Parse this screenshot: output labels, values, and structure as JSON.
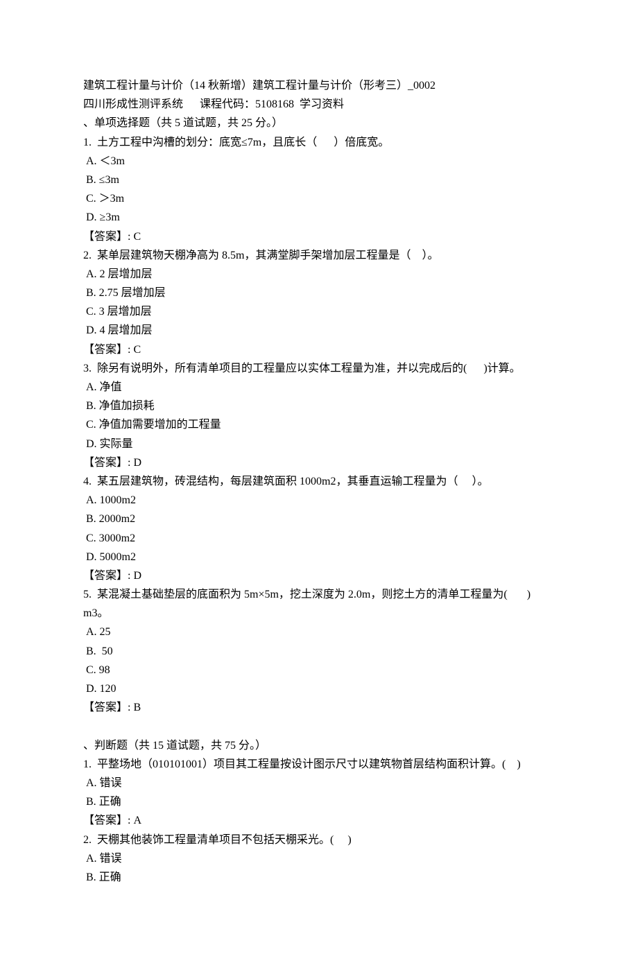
{
  "header": {
    "line1": "建筑工程计量与计价（14 秋新增）建筑工程计量与计价（形考三）_0002",
    "line2": "四川形成性测评系统      课程代码：5108168  学习资料"
  },
  "section1": {
    "title": "、单项选择题（共 5 道试题，共 25 分。）",
    "q1": {
      "stem": "1.  土方工程中沟槽的划分：底宽≤7m，且底长（      ）倍底宽。",
      "optA": " A. ＜3m",
      "optB": " B. ≤3m",
      "optC": " C. ＞3m",
      "optD": " D. ≥3m",
      "answer": "【答案】: C"
    },
    "q2": {
      "stem": "2.  某单层建筑物天棚净高为 8.5m，其满堂脚手架增加层工程量是（    ）。",
      "optA": " A. 2 层增加层",
      "optB": " B. 2.75 层增加层",
      "optC": " C. 3 层增加层",
      "optD": " D. 4 层增加层",
      "answer": "【答案】: C"
    },
    "q3": {
      "stem": "3.  除另有说明外，所有清单项目的工程量应以实体工程量为准，并以完成后的(      )计算。",
      "optA": " A. 净值",
      "optB": " B. 净值加损耗",
      "optC": " C. 净值加需要增加的工程量",
      "optD": " D. 实际量",
      "answer": "【答案】: D"
    },
    "q4": {
      "stem": "4.  某五层建筑物，砖混结构，每层建筑面积 1000m2，其垂直运输工程量为（     ）。",
      "optA": " A. 1000m2",
      "optB": " B. 2000m2",
      "optC": " C. 3000m2",
      "optD": " D. 5000m2",
      "answer": "【答案】: D"
    },
    "q5": {
      "stem": "5.  某混凝土基础垫层的底面积为 5m×5m，挖土深度为 2.0m，则挖土方的清单工程量为(       ) m3。",
      "optA": " A. 25",
      "optB": " B.  50",
      "optC": " C. 98",
      "optD": " D. 120",
      "answer": "【答案】: B"
    }
  },
  "section2": {
    "title": "、判断题（共 15 道试题，共 75 分。）",
    "q1": {
      "stem": "1.  平整场地（010101001）项目其工程量按设计图示尺寸以建筑物首层结构面积计算。(    )",
      "optA": " A. 错误",
      "optB": " B. 正确",
      "answer": "【答案】: A"
    },
    "q2": {
      "stem": "2.  天棚其他装饰工程量清单项目不包括天棚采光。(     )",
      "optA": " A. 错误",
      "optB": " B. 正确"
    }
  }
}
